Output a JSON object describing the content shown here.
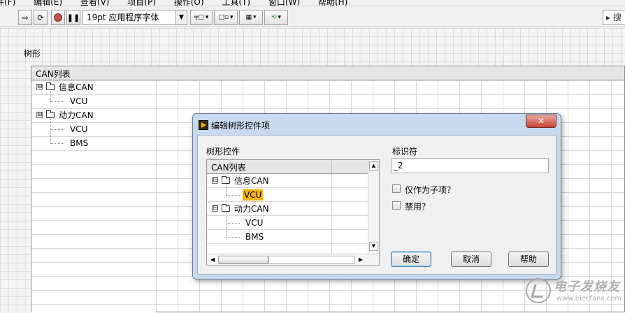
{
  "menubar": {
    "items": [
      "件(F)",
      "编辑(E)",
      "查看(V)",
      "项目(P)",
      "操作(O)",
      "工具(T)",
      "窗口(W)",
      "帮助(H)"
    ]
  },
  "toolbar": {
    "run_arrow_icon": "run-arrow-icon",
    "run_continuous_icon": "run-continuous-icon",
    "abort_icon": "abort-icon",
    "pause_icon": "pause-icon",
    "font_select_value": "19pt 应用程序字体",
    "search_placeholder": "搜"
  },
  "panel": {
    "tree_label": "树形"
  },
  "tree": {
    "header": "CAN列表",
    "rows": [
      {
        "label": "信息CAN",
        "level": 0,
        "expander": "⊟"
      },
      {
        "label": "VCU",
        "level": 1
      },
      {
        "label": "动力CAN",
        "level": 0,
        "expander": "⊟"
      },
      {
        "label": "VCU",
        "level": 1
      },
      {
        "label": "BMS",
        "level": 1
      }
    ]
  },
  "dialog": {
    "title": "编辑树形控件项",
    "close": "✕",
    "tree_section_label": "树形控件",
    "identifier_label": "标识符",
    "identifier_value": "_2",
    "mini_tree": {
      "header": "CAN列表",
      "rows": [
        {
          "label": "信息CAN",
          "level": 0,
          "expander": "⊟"
        },
        {
          "label": "VCU",
          "level": 1,
          "selected": true
        },
        {
          "label": "动力CAN",
          "level": 0,
          "expander": "⊟"
        },
        {
          "label": "VCU",
          "level": 1
        },
        {
          "label": "BMS",
          "level": 1
        }
      ]
    },
    "checkbox_child_only": "仅作为子项？",
    "checkbox_disabled": "禁用？",
    "ok_button": "确定",
    "cancel_button": "取消",
    "help_button": "帮助"
  },
  "watermark": {
    "title": "电子发烧友",
    "url": "www.elecfans.com"
  },
  "colors": {
    "selection": "#f5b400",
    "dialog_frame": "#c9d9ee",
    "close_button": "#c6463a"
  }
}
